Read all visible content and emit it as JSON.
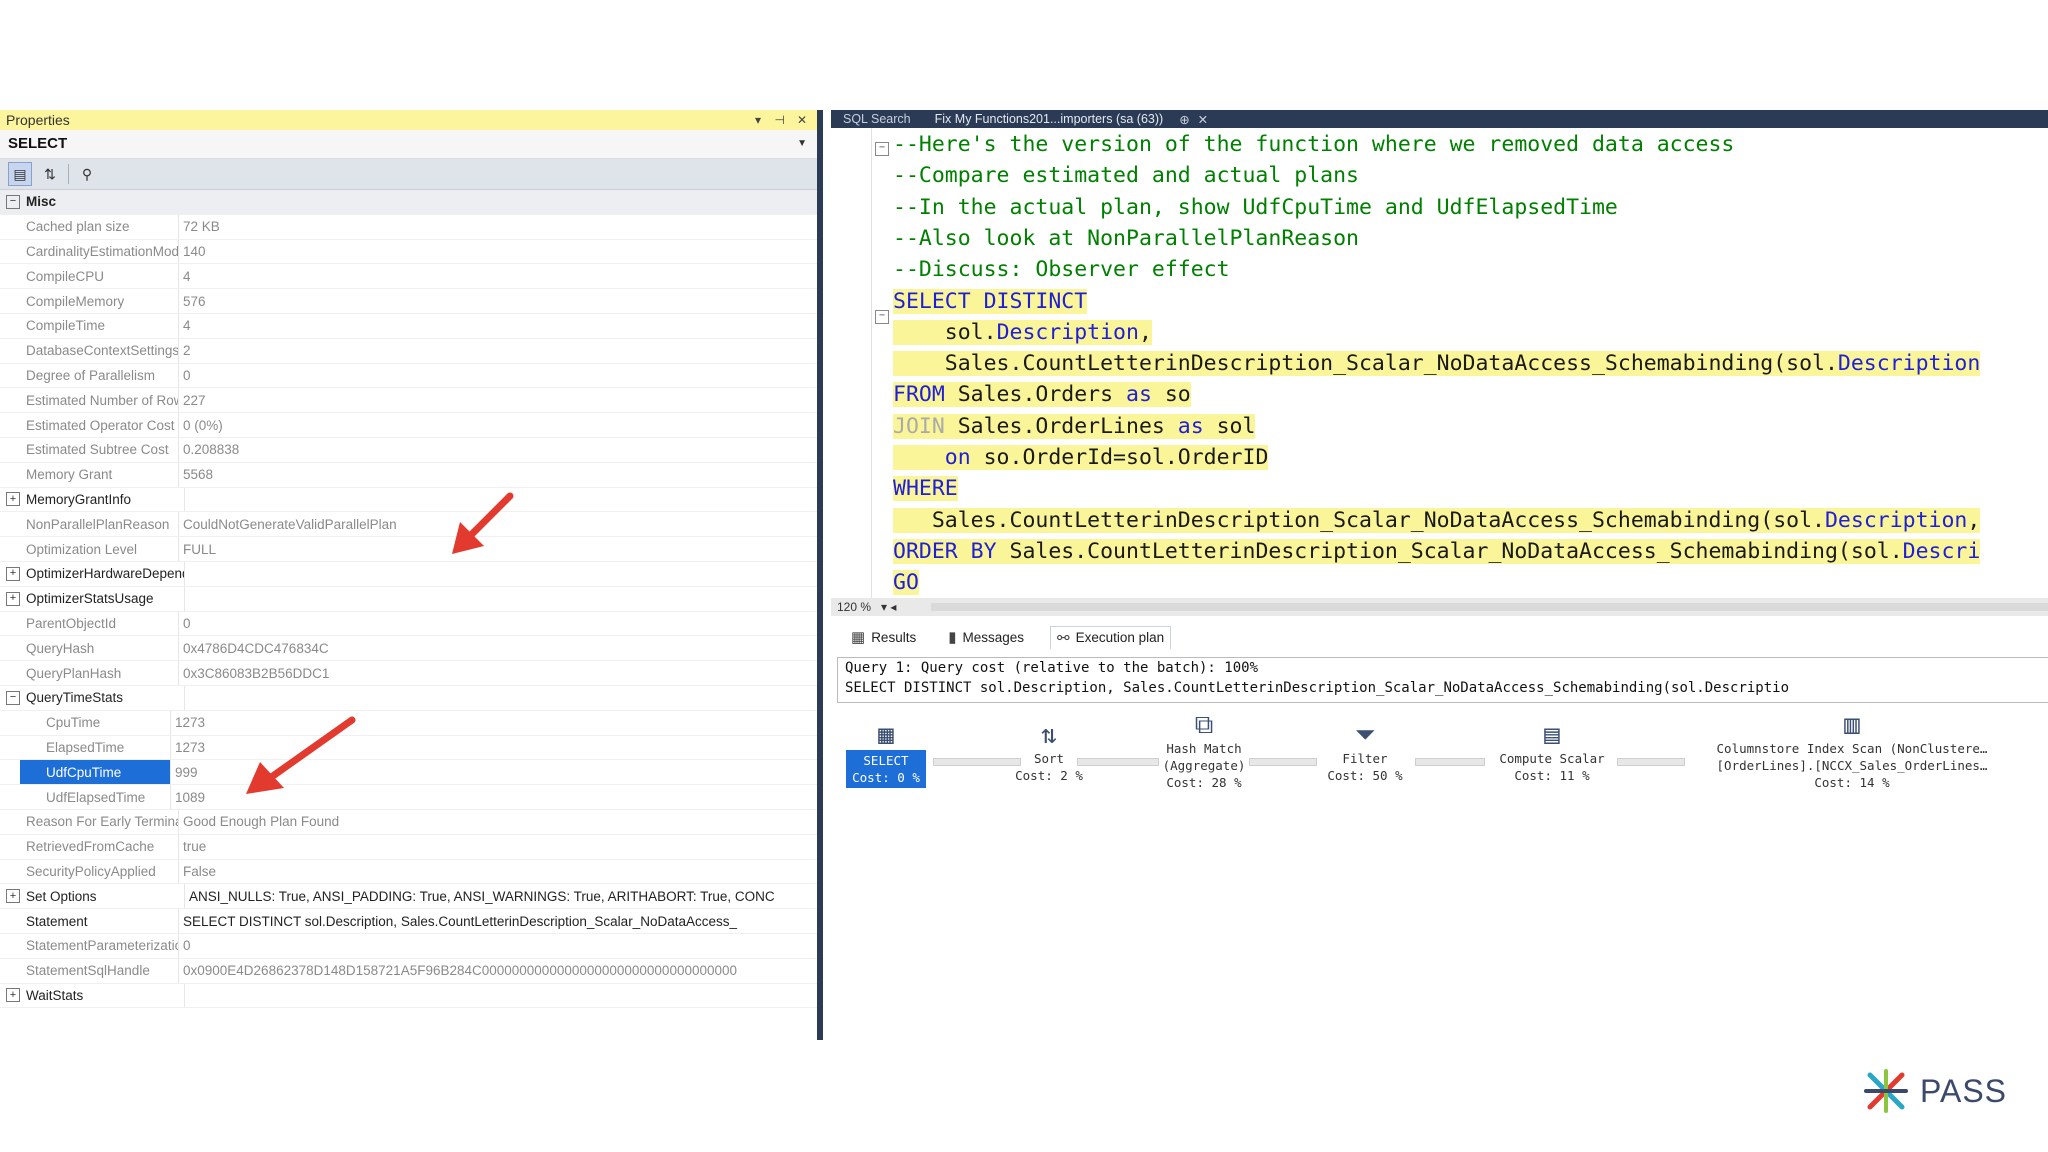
{
  "properties": {
    "title": "Properties",
    "selected_object": "SELECT",
    "rows": [
      {
        "kind": "cat",
        "expander": "⊟",
        "name": "Misc",
        "value": ""
      },
      {
        "kind": "prop",
        "name": "Cached plan size",
        "value": "72 KB"
      },
      {
        "kind": "prop",
        "name": "CardinalityEstimationModelVersion",
        "value": "140"
      },
      {
        "kind": "prop",
        "name": "CompileCPU",
        "value": "4"
      },
      {
        "kind": "prop",
        "name": "CompileMemory",
        "value": "576"
      },
      {
        "kind": "prop",
        "name": "CompileTime",
        "value": "4"
      },
      {
        "kind": "prop",
        "name": "DatabaseContextSettingsId",
        "value": "2"
      },
      {
        "kind": "prop",
        "name": "Degree of Parallelism",
        "value": "0"
      },
      {
        "kind": "prop",
        "name": "Estimated Number of Rows",
        "value": "227"
      },
      {
        "kind": "prop",
        "name": "Estimated Operator Cost",
        "value": "0 (0%)"
      },
      {
        "kind": "prop",
        "name": "Estimated Subtree Cost",
        "value": "0.208838"
      },
      {
        "kind": "prop",
        "name": "Memory Grant",
        "value": "5568"
      },
      {
        "kind": "grp",
        "expander": "⊞",
        "name": "MemoryGrantInfo",
        "value": ""
      },
      {
        "kind": "prop",
        "name": "NonParallelPlanReason",
        "value": "CouldNotGenerateValidParallelPlan"
      },
      {
        "kind": "prop",
        "name": "Optimization Level",
        "value": "FULL"
      },
      {
        "kind": "grp",
        "expander": "⊞",
        "name": "OptimizerHardwareDependentProperties",
        "value": ""
      },
      {
        "kind": "grp",
        "expander": "⊞",
        "name": "OptimizerStatsUsage",
        "value": ""
      },
      {
        "kind": "prop",
        "name": "ParentObjectId",
        "value": "0"
      },
      {
        "kind": "prop",
        "name": "QueryHash",
        "value": "0x4786D4CDC476834C"
      },
      {
        "kind": "prop",
        "name": "QueryPlanHash",
        "value": "0x3C86083B2B56DDC1"
      },
      {
        "kind": "grp",
        "expander": "⊟",
        "name": "QueryTimeStats",
        "value": ""
      },
      {
        "kind": "sub",
        "name": "CpuTime",
        "value": "1273"
      },
      {
        "kind": "sub",
        "name": "ElapsedTime",
        "value": "1273"
      },
      {
        "kind": "subsel",
        "name": "UdfCpuTime",
        "value": "999"
      },
      {
        "kind": "sub",
        "name": "UdfElapsedTime",
        "value": "1089"
      },
      {
        "kind": "prop",
        "name": "Reason For Early Termination",
        "value": "Good Enough Plan Found"
      },
      {
        "kind": "prop",
        "name": "RetrievedFromCache",
        "value": "true"
      },
      {
        "kind": "prop",
        "name": "SecurityPolicyApplied",
        "value": "False"
      },
      {
        "kind": "grp",
        "expander": "⊞",
        "name": "Set Options",
        "value": "ANSI_NULLS: True, ANSI_PADDING: True, ANSI_WARNINGS: True, ARITHABORT: True, CONC"
      },
      {
        "kind": "dark",
        "name": "Statement",
        "value": "SELECT DISTINCT    sol.Description,    Sales.CountLetterinDescription_Scalar_NoDataAccess_"
      },
      {
        "kind": "prop",
        "name": "StatementParameterization",
        "value": "0"
      },
      {
        "kind": "prop",
        "name": "StatementSqlHandle",
        "value": "0x0900E4D26862378D148D158721A5F96B284C0000000000000000000000000000000000"
      },
      {
        "kind": "grp",
        "expander": "⊞",
        "name": "WaitStats",
        "value": ""
      }
    ]
  },
  "editor": {
    "tabs": [
      "SQL Search",
      "Fix My Functions201...importers (sa (63))",
      "⊕",
      "✕"
    ],
    "code_lines": [
      [
        {
          "c": "cm",
          "t": "--Here's the version of the function where we removed data access"
        }
      ],
      [
        {
          "c": "cm",
          "t": "--Compare estimated and actual plans"
        }
      ],
      [
        {
          "c": "cm",
          "t": "--In the actual plan, show UdfCpuTime and UdfElapsedTime"
        }
      ],
      [
        {
          "c": "cm",
          "t": "--Also look at NonParallelPlanReason"
        }
      ],
      [
        {
          "c": "cm",
          "t": "--Discuss: Observer effect"
        }
      ],
      [
        {
          "c": "kw",
          "t": "SELECT DISTINCT"
        }
      ],
      [
        {
          "c": "tx",
          "t": "    sol."
        },
        {
          "c": "kw",
          "t": "Description"
        },
        {
          "c": "tx",
          "t": ","
        }
      ],
      [
        {
          "c": "tx",
          "t": "    Sales.CountLetterinDescription_Scalar_NoDataAccess_Schemabinding(sol."
        },
        {
          "c": "kw",
          "t": "Description"
        }
      ],
      [
        {
          "c": "kw",
          "t": "FROM"
        },
        {
          "c": "tx",
          "t": " Sales.Orders "
        },
        {
          "c": "kw",
          "t": "as"
        },
        {
          "c": "tx",
          "t": " so"
        }
      ],
      [
        {
          "c": "ks",
          "t": "JOIN"
        },
        {
          "c": "tx",
          "t": " Sales.OrderLines "
        },
        {
          "c": "kw",
          "t": "as"
        },
        {
          "c": "tx",
          "t": " sol"
        }
      ],
      [
        {
          "c": "tx",
          "t": "    "
        },
        {
          "c": "kw",
          "t": "on"
        },
        {
          "c": "tx",
          "t": " so.OrderId=sol.OrderID"
        }
      ],
      [
        {
          "c": "kw",
          "t": "WHERE"
        }
      ],
      [
        {
          "c": "tx",
          "t": "   Sales.CountLetterinDescription_Scalar_NoDataAccess_Schemabinding(sol."
        },
        {
          "c": "kw",
          "t": "Description"
        },
        {
          "c": "tx",
          "t": ","
        }
      ],
      [
        {
          "c": "kw",
          "t": "ORDER BY"
        },
        {
          "c": "tx",
          "t": " Sales.CountLetterinDescription_Scalar_NoDataAccess_Schemabinding(sol."
        },
        {
          "c": "kw",
          "t": "Descri"
        }
      ],
      [
        {
          "c": "kw",
          "t": "GO"
        }
      ]
    ],
    "zoom": "120 %"
  },
  "results": {
    "tabs": [
      "Results",
      "Messages",
      "Execution plan"
    ],
    "query_line1": "Query 1: Query cost (relative to the batch): 100%",
    "query_line2": "SELECT DISTINCT sol.Description, Sales.CountLetterinDescription_Scalar_NoDataAccess_Schemabinding(sol.Descriptio",
    "plan_nodes": [
      {
        "icon": "▦",
        "label": "SELECT",
        "cost": "Cost: 0 %"
      },
      {
        "icon": "⇅",
        "label": "Sort",
        "cost": "Cost: 2 %"
      },
      {
        "icon": "⧉",
        "label": "Hash Match",
        "label2": "(Aggregate)",
        "cost": "Cost: 28 %"
      },
      {
        "icon": "⏷",
        "label": "Filter",
        "cost": "Cost: 50 %"
      },
      {
        "icon": "▤",
        "label": "Compute Scalar",
        "cost": "Cost: 11 %"
      },
      {
        "icon": "▥",
        "label": "Columnstore Index Scan (NonClustere…",
        "label2": "[OrderLines].[NCCX_Sales_OrderLines…",
        "cost": "Cost: 14 %"
      }
    ]
  },
  "brand": {
    "name": "PASS"
  },
  "colors": {
    "accent_red": "#e23a2e",
    "highlight": "#fbf59a",
    "selection": "#1e6ed8"
  }
}
